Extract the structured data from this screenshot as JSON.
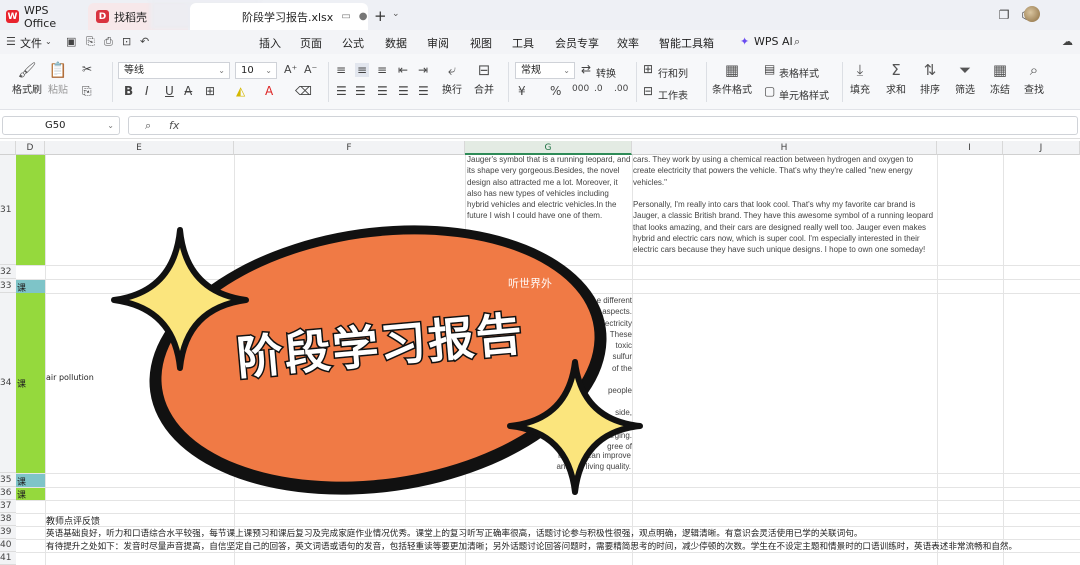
{
  "titlebar": {
    "app_tab": "WPS Office",
    "doc_tab_1": "找稻壳",
    "active_tab": "阶段学习报告.xlsx"
  },
  "menu": {
    "file": "文件",
    "items": [
      "插入",
      "页面",
      "公式",
      "数据",
      "审阅",
      "视图",
      "工具",
      "会员专享",
      "效率",
      "智能工具箱"
    ],
    "ai": "WPS AI"
  },
  "ribbon": {
    "format_painter": "格式刷",
    "paste": "粘贴",
    "font_name": "等线",
    "font_size": "10",
    "wrap": "换行",
    "merge": "合并",
    "number_format": "常规",
    "convert": "转换",
    "row_col": "行和列",
    "worksheet": "工作表",
    "cond_format": "条件格式",
    "table_style": "表格样式",
    "cell_style": "单元格样式",
    "fill": "填充",
    "sum": "求和",
    "sort": "排序",
    "filter": "筛选",
    "freeze": "冻结",
    "find": "查找"
  },
  "formula_bar": {
    "cell_ref": "G50",
    "fx": "fx"
  },
  "grid": {
    "columns": [
      "D",
      "E",
      "F",
      "G",
      "H",
      "I",
      "J"
    ],
    "rows": [
      "31",
      "32",
      "33",
      "34",
      "35",
      "36",
      "37",
      "38",
      "39",
      "40",
      "41"
    ],
    "ke": "课",
    "e34": "air pollution",
    "g31": "Jauger's symbol that is a running leopard, and its shape very gorgeous.Besides, the novel design also attracted me a lot. Moreover, it also has new types of vehicles including hybrid vehicles and electric vehicles.In the future I wish I could have one of them.",
    "h31a": "cars. They work by using a chemical reaction between hydrogen and oxygen to create electricity that powers the vehicle. That's why they're called \"new energy vehicles.\"",
    "h31b": "Personally, I'm really into cars that look cool. That's why my favorite car brand is Jauger, a classic British brand. They have this awesome symbol of a running leopard that looks amazing, and their cars are designed really well too. Jauger even makes hybrid and electric cars now, which is super cool. I'm especially interested in their electric cars because they have such unique designs. I hope to own one someday!",
    "g34_fragments": [
      "e different",
      "e aspects.",
      "electricity",
      "These",
      "toxic",
      "sulfur",
      "of the",
      "people",
      "side,",
      "harging.",
      "gree of",
      "lic, they can improve",
      "and our living quality."
    ],
    "e38": "教师点评反馈",
    "e39": "英语基础良好，听力和口语综合水平较强，每节课上课预习和课后复习及完成家庭作业情况优秀。课堂上的复习听写正确率很高，话题讨论参与积极性很强，观点明确，逻辑清晰。有意识会灵活使用已学的关联词句。",
    "e40": "有待提升之处如下：发音时尽量声音提高，自信坚定自己的回答，英文词语或语句的发音，包括轻重读等要更加清晰；另外话题讨论回答问题时，需要精简思考的时间，减少停顿的次数。学生在不设定主题和情景时的口语训练时，英语表述非常流畅和自然。"
  },
  "overlay": {
    "title": "阶段学习报告",
    "watermark": "听世界外"
  },
  "colors": {
    "badge_orange": "#f07a45",
    "badge_stroke": "#111111",
    "star_yellow": "#fbe57d",
    "green_fill": "#95d93d",
    "teal_fill": "#7ec4c8"
  }
}
